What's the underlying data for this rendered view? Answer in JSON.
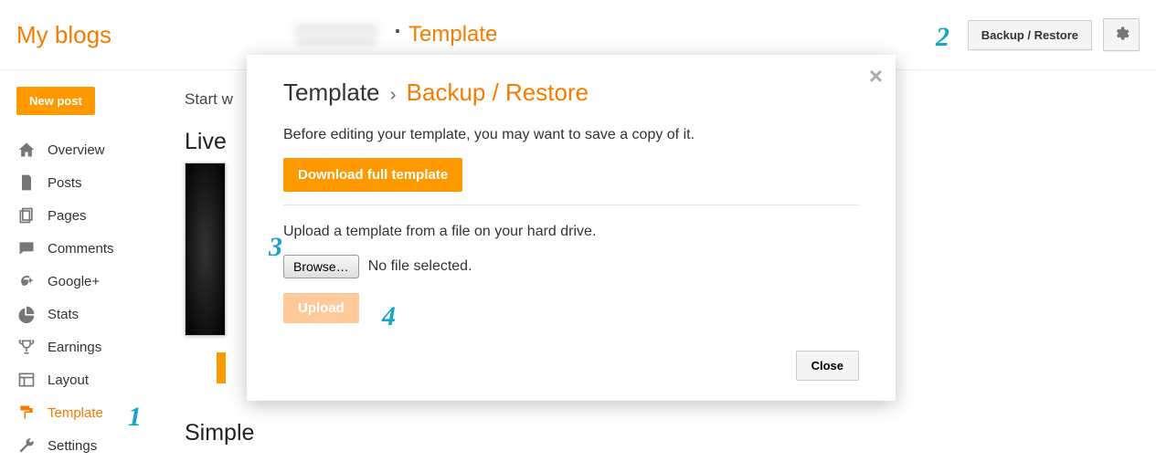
{
  "header": {
    "brand": "My blogs",
    "page_name": "Template",
    "backup_restore_btn": "Backup / Restore"
  },
  "sidebar": {
    "new_post_btn": "New post",
    "items": [
      {
        "label": "Overview"
      },
      {
        "label": "Posts"
      },
      {
        "label": "Pages"
      },
      {
        "label": "Comments"
      },
      {
        "label": "Google+"
      },
      {
        "label": "Stats"
      },
      {
        "label": "Earnings"
      },
      {
        "label": "Layout"
      },
      {
        "label": "Template"
      },
      {
        "label": "Settings"
      }
    ]
  },
  "main": {
    "start_with": "Start w",
    "live": "Live",
    "simple": "Simple"
  },
  "modal": {
    "title_left": "Template",
    "title_right": "Backup / Restore",
    "copy_text": "Before editing your template, you may want to save a copy of it.",
    "download_btn": "Download full template",
    "upload_text": "Upload a template from a file on your hard drive.",
    "browse_btn": "Browse…",
    "no_file": "No file selected.",
    "upload_btn": "Upload",
    "close_btn": "Close"
  },
  "callouts": {
    "c1": "1",
    "c2": "2",
    "c3": "3",
    "c4": "4"
  }
}
